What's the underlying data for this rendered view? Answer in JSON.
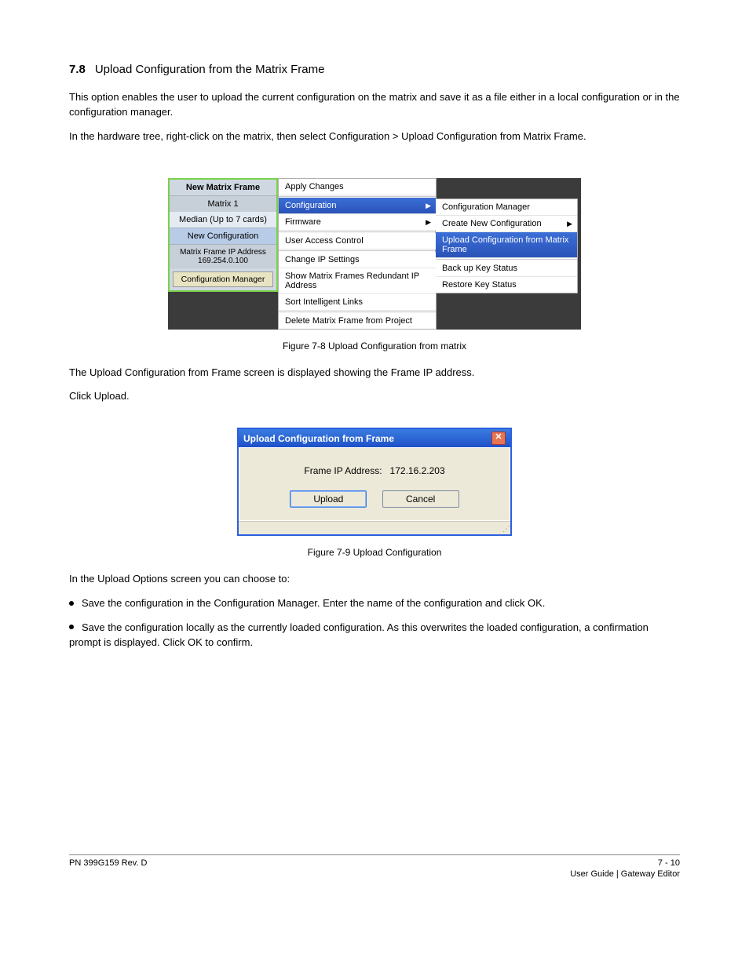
{
  "header": {
    "section_number": "7.8",
    "section_title": "Upload Configuration from the Matrix Frame",
    "para1": "This option enables the user to upload the current configuration on the matrix and save it as a file either in a local configuration or in the configuration manager.",
    "para2": "In the hardware tree, right-click on the matrix, then select Configuration > Upload Configuration from Matrix Frame."
  },
  "figure1": {
    "caption": "Figure 7-8 Upload Configuration from matrix",
    "sidebar": {
      "header": "New Matrix Frame",
      "items": [
        {
          "label": "Matrix 1",
          "cls": "plain"
        },
        {
          "label": "Median (Up to 7 cards)",
          "cls": ""
        },
        {
          "label": "New Configuration",
          "cls": "sel"
        },
        {
          "label_html": "Matrix Frame IP Address<br>169.254.0.100",
          "cls": "plain"
        },
        {
          "label": "Configuration Manager",
          "cls": "btn"
        }
      ]
    },
    "menu1": [
      {
        "label": "Apply Changes"
      },
      {
        "label": "Configuration",
        "hl": true,
        "arrow": true
      },
      {
        "label": "Firmware",
        "arrow": true
      },
      {
        "label": "User Access Control"
      },
      {
        "label": "Change IP Settings"
      },
      {
        "label": "Show Matrix Frames Redundant IP Address"
      },
      {
        "label": "Sort Intelligent Links"
      },
      {
        "label": "Delete Matrix Frame from Project"
      }
    ],
    "menu2": [
      {
        "label": "Configuration Manager"
      },
      {
        "label": "Create New Configuration",
        "arrow": true
      },
      {
        "label": "Upload Configuration from Matrix Frame",
        "hl": true
      },
      {
        "sep": true
      },
      {
        "label": "Back up Key Status"
      },
      {
        "label": "Restore Key Status"
      }
    ]
  },
  "mid_text": {
    "para1": "The Upload Configuration from Frame screen is displayed showing the Frame IP address.",
    "para2": "Click Upload."
  },
  "figure2": {
    "caption": "Figure 7-9 Upload Configuration",
    "title": "Upload Configuration from Frame",
    "ip_label": "Frame IP Address:",
    "ip_value": "172.16.2.203",
    "btn_upload": "Upload",
    "btn_cancel": "Cancel"
  },
  "steps": {
    "intro": "In the Upload Options screen you can choose to:",
    "opt1": "Save the configuration in the Configuration Manager. Enter the name of the configuration and click OK.",
    "opt2": "Save the configuration locally as the currently loaded configuration. As this overwrites the loaded configuration, a confirmation prompt is displayed. Click OK to confirm."
  },
  "footer": {
    "left": "PN 399G159 Rev. D",
    "center": "",
    "right": "7 - 10",
    "bottom": "User Guide  |  Gateway Editor"
  }
}
